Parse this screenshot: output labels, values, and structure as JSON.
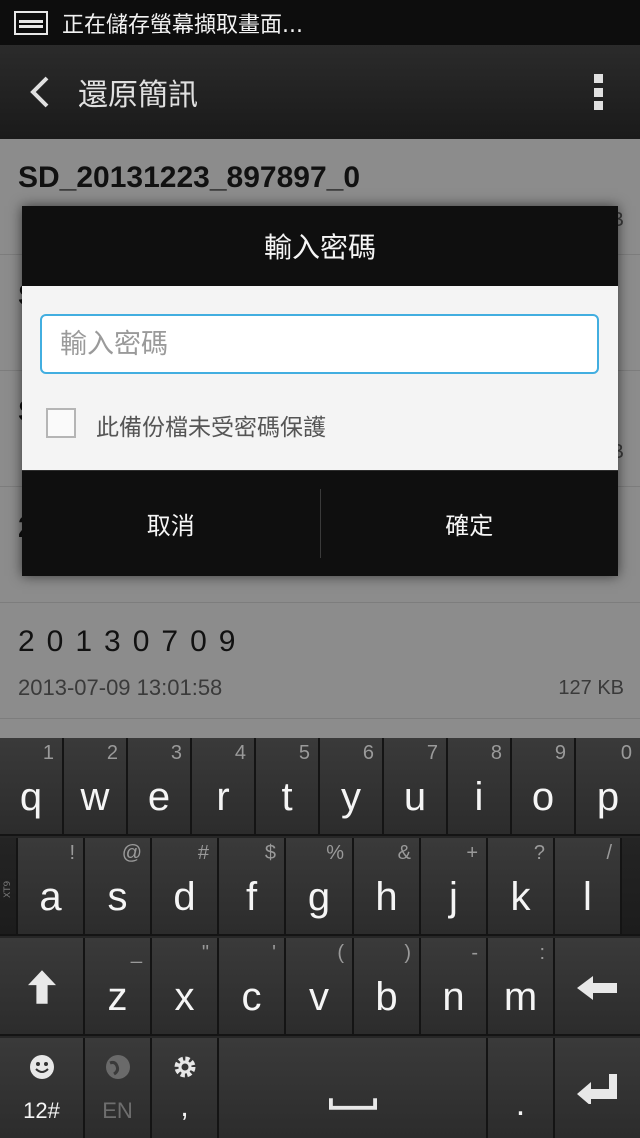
{
  "status_bar": {
    "text": "正在儲存螢幕擷取畫面..."
  },
  "action_bar": {
    "title": "還原簡訊"
  },
  "list": [
    {
      "title": "SD_20131223_897897_0",
      "size": "B"
    },
    {
      "title": "S",
      "size": ""
    },
    {
      "title": "S",
      "size": "B"
    },
    {
      "title": "2",
      "size": ""
    },
    {
      "title": "20130709",
      "date": "2013-07-09 13:01:58",
      "size": "127 KB"
    }
  ],
  "dialog": {
    "title": "輸入密碼",
    "input_placeholder": "輸入密碼",
    "checkbox_label": "此備份檔未受密碼保護",
    "cancel_label": "取消",
    "ok_label": "確定"
  },
  "keyboard": {
    "row1": [
      {
        "main": "q",
        "hint": "1"
      },
      {
        "main": "w",
        "hint": "2"
      },
      {
        "main": "e",
        "hint": "3"
      },
      {
        "main": "r",
        "hint": "4"
      },
      {
        "main": "t",
        "hint": "5"
      },
      {
        "main": "y",
        "hint": "6"
      },
      {
        "main": "u",
        "hint": "7"
      },
      {
        "main": "i",
        "hint": "8"
      },
      {
        "main": "o",
        "hint": "9"
      },
      {
        "main": "p",
        "hint": "0"
      }
    ],
    "row2": [
      {
        "main": "a",
        "hint": "!"
      },
      {
        "main": "s",
        "hint": "@"
      },
      {
        "main": "d",
        "hint": "#"
      },
      {
        "main": "f",
        "hint": "$"
      },
      {
        "main": "g",
        "hint": "%"
      },
      {
        "main": "h",
        "hint": "&"
      },
      {
        "main": "j",
        "hint": "+"
      },
      {
        "main": "k",
        "hint": "?"
      },
      {
        "main": "l",
        "hint": "/"
      }
    ],
    "row3": [
      {
        "main": "z",
        "hint": "_"
      },
      {
        "main": "x",
        "hint": "\""
      },
      {
        "main": "c",
        "hint": "'"
      },
      {
        "main": "v",
        "hint": "("
      },
      {
        "main": "b",
        "hint": ")"
      },
      {
        "main": "n",
        "hint": "-"
      },
      {
        "main": "m",
        "hint": ":"
      }
    ],
    "xt9_label": "XT9",
    "symbols_label": "12#",
    "language_label": "EN",
    "comma_label": ",",
    "period_label": "."
  },
  "colors": {
    "accent": "#42aee0",
    "dialog_bg": "#0f0f0f",
    "body_bg": "#f4f4f4"
  }
}
